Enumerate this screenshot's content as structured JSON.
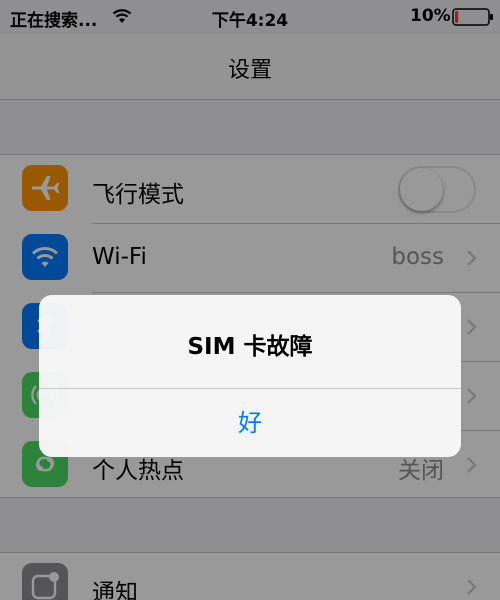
{
  "status_bar": {
    "carrier": "正在搜索...",
    "time": "下午4:24",
    "battery_percent": "10%",
    "battery_level": 0.1,
    "battery_color": "#ff3b30"
  },
  "nav": {
    "title": "设置"
  },
  "settings": {
    "airplane": {
      "label": "飞行模式",
      "icon": "airplane-icon",
      "icon_color": "#ff9500",
      "toggle_on": false
    },
    "wifi": {
      "label": "Wi-Fi",
      "value": "boss",
      "icon": "wifi-icon",
      "icon_color": "#007aff"
    },
    "bluetooth": {
      "icon": "bluetooth-icon",
      "icon_color": "#007aff"
    },
    "cellular": {
      "icon": "cellular-icon",
      "icon_color": "#4cd964"
    },
    "hotspot": {
      "label": "个人热点",
      "value": "关闭",
      "icon": "hotspot-icon",
      "icon_color": "#4cd964"
    },
    "notifications": {
      "label": "通知",
      "icon": "notifications-icon",
      "icon_color": "#8e8e93"
    }
  },
  "alert": {
    "title": "SIM 卡故障",
    "ok_label": "好",
    "button_color": "#007aff"
  }
}
